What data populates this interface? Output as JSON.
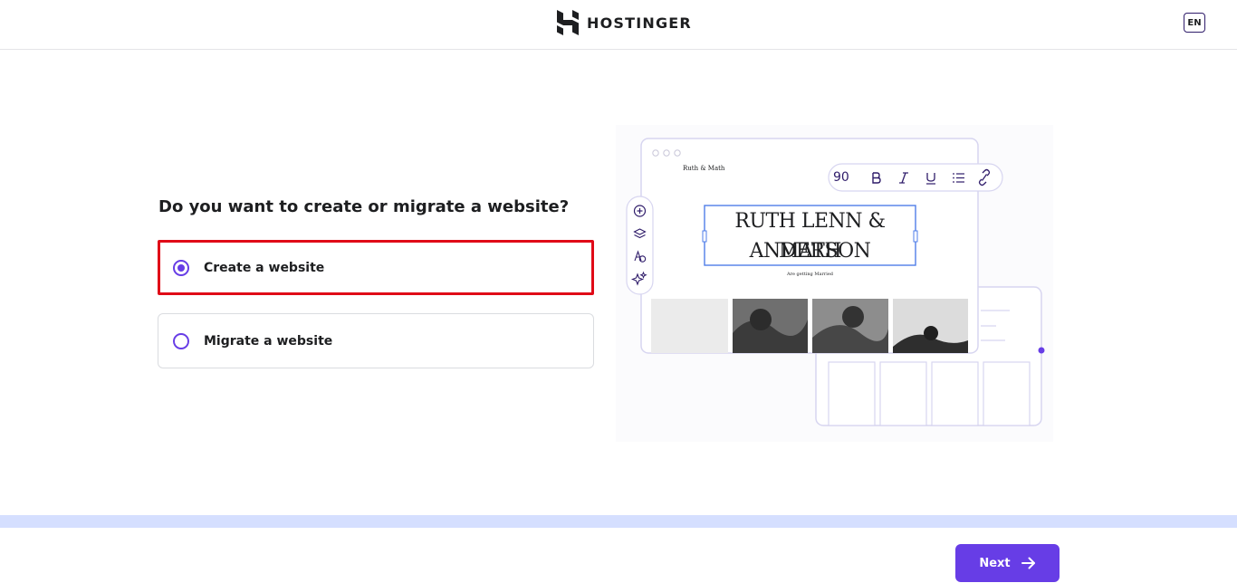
{
  "header": {
    "brand": "HOSTINGER",
    "language": "EN"
  },
  "main": {
    "question": "Do you want to create or migrate a website?",
    "options": [
      {
        "label": "Create a website",
        "selected": true
      },
      {
        "label": "Migrate a website",
        "selected": false
      }
    ]
  },
  "illustration": {
    "site_name": "Ruth & Math",
    "headline_line1": "RUTH LENN & MATH",
    "headline_line2": "ANDERSON",
    "subtitle": "Are getting Married",
    "font_size": "90",
    "toolbar_icons": [
      "bold-icon",
      "italic-icon",
      "underline-icon",
      "list-icon",
      "link-icon"
    ],
    "side_icons": [
      "add-icon",
      "layers-icon",
      "text-style-icon",
      "ai-sparkle-icon"
    ]
  },
  "footer": {
    "next_label": "Next"
  },
  "colors": {
    "accent": "#673de6",
    "highlight": "#e00a17",
    "progress_track": "#d5dfff"
  }
}
